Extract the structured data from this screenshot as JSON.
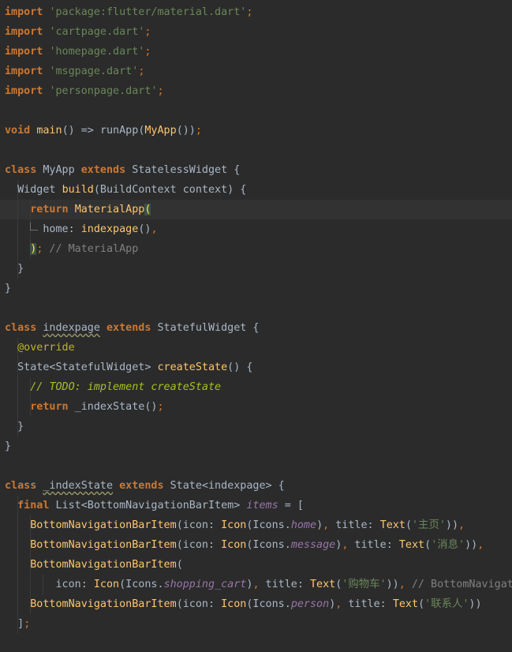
{
  "editor": {
    "lines": [
      {
        "tokens": [
          {
            "t": "import",
            "c": "kw"
          },
          {
            "t": " "
          },
          {
            "t": "'package:flutter/material.dart'",
            "c": "str"
          },
          {
            "t": ";",
            "c": "punct"
          }
        ]
      },
      {
        "tokens": [
          {
            "t": "import",
            "c": "kw"
          },
          {
            "t": " "
          },
          {
            "t": "'cartpage.dart'",
            "c": "str"
          },
          {
            "t": ";",
            "c": "punct"
          }
        ]
      },
      {
        "tokens": [
          {
            "t": "import",
            "c": "kw"
          },
          {
            "t": " "
          },
          {
            "t": "'homepage.dart'",
            "c": "str"
          },
          {
            "t": ";",
            "c": "punct"
          }
        ]
      },
      {
        "tokens": [
          {
            "t": "import",
            "c": "kw"
          },
          {
            "t": " "
          },
          {
            "t": "'msgpage.dart'",
            "c": "str"
          },
          {
            "t": ";",
            "c": "punct"
          }
        ]
      },
      {
        "tokens": [
          {
            "t": "import",
            "c": "kw"
          },
          {
            "t": " "
          },
          {
            "t": "'personpage.dart'",
            "c": "str"
          },
          {
            "t": ";",
            "c": "punct"
          }
        ]
      },
      {
        "tokens": []
      },
      {
        "tokens": [
          {
            "t": "void",
            "c": "kw"
          },
          {
            "t": " "
          },
          {
            "t": "main",
            "c": "fn"
          },
          {
            "t": "() => "
          },
          {
            "t": "runApp"
          },
          {
            "t": "("
          },
          {
            "t": "MyApp",
            "c": "fn"
          },
          {
            "t": "())"
          },
          {
            "t": ";",
            "c": "punct"
          }
        ]
      },
      {
        "tokens": []
      },
      {
        "tokens": [
          {
            "t": "class",
            "c": "kw"
          },
          {
            "t": " MyApp "
          },
          {
            "t": "extends",
            "c": "kw"
          },
          {
            "t": " StatelessWidget {"
          }
        ]
      },
      {
        "tokens": [
          {
            "t": "  Widget "
          },
          {
            "t": "build",
            "c": "fn"
          },
          {
            "t": "(BuildContext context) {"
          }
        ]
      },
      {
        "current": true,
        "tokens": [
          {
            "t": "    "
          },
          {
            "t": "return",
            "c": "kw"
          },
          {
            "t": " "
          },
          {
            "t": "MaterialApp",
            "c": "fn"
          },
          {
            "t": "(",
            "c": "hl"
          }
        ]
      },
      {
        "elbow": true,
        "tokens": [
          {
            "t": "      home: "
          },
          {
            "t": "indexpage",
            "c": "fn"
          },
          {
            "t": "()"
          },
          {
            "t": ",",
            "c": "punct"
          }
        ]
      },
      {
        "tokens": [
          {
            "t": "    "
          },
          {
            "t": ")",
            "c": "hl"
          },
          {
            "t": ";",
            "c": "punct"
          },
          {
            "t": " // MaterialApp",
            "c": "cmt"
          }
        ]
      },
      {
        "tokens": [
          {
            "t": "  }"
          }
        ]
      },
      {
        "tokens": [
          {
            "t": "}"
          }
        ]
      },
      {
        "tokens": []
      },
      {
        "tokens": [
          {
            "t": "class",
            "c": "kw"
          },
          {
            "t": " "
          },
          {
            "t": "indexpage",
            "c": "wavy"
          },
          {
            "t": " "
          },
          {
            "t": "extends",
            "c": "kw"
          },
          {
            "t": " StatefulWidget {"
          }
        ]
      },
      {
        "tokens": [
          {
            "t": "  "
          },
          {
            "t": "@override",
            "c": "ann"
          }
        ]
      },
      {
        "tokens": [
          {
            "t": "  State<StatefulWidget> "
          },
          {
            "t": "createState",
            "c": "fn"
          },
          {
            "t": "() {"
          }
        ]
      },
      {
        "tokens": [
          {
            "t": "    "
          },
          {
            "t": "// ",
            "c": "todo"
          },
          {
            "t": "TODO: implement createState",
            "c": "todo"
          }
        ]
      },
      {
        "tokens": [
          {
            "t": "    "
          },
          {
            "t": "return",
            "c": "kw"
          },
          {
            "t": " _indexState()"
          },
          {
            "t": ";",
            "c": "punct"
          }
        ]
      },
      {
        "tokens": [
          {
            "t": "  }"
          }
        ]
      },
      {
        "tokens": [
          {
            "t": "}"
          }
        ]
      },
      {
        "tokens": []
      },
      {
        "tokens": [
          {
            "t": "class",
            "c": "kw"
          },
          {
            "t": " "
          },
          {
            "t": "_indexState",
            "c": "wavy"
          },
          {
            "t": " "
          },
          {
            "t": "extends",
            "c": "kw"
          },
          {
            "t": " State<indexpage> {"
          }
        ]
      },
      {
        "tokens": [
          {
            "t": "  "
          },
          {
            "t": "final",
            "c": "kw"
          },
          {
            "t": " List<BottomNavigationBarItem> "
          },
          {
            "t": "items",
            "c": "fld"
          },
          {
            "t": " = ["
          }
        ]
      },
      {
        "tokens": [
          {
            "t": "    "
          },
          {
            "t": "BottomNavigationBarItem",
            "c": "fn"
          },
          {
            "t": "(icon: "
          },
          {
            "t": "Icon",
            "c": "fn"
          },
          {
            "t": "(Icons."
          },
          {
            "t": "home",
            "c": "fld"
          },
          {
            "t": ")"
          },
          {
            "t": ",",
            "c": "punct"
          },
          {
            "t": " title: "
          },
          {
            "t": "Text",
            "c": "fn"
          },
          {
            "t": "("
          },
          {
            "t": "'主页'",
            "c": "str"
          },
          {
            "t": "))"
          },
          {
            "t": ",",
            "c": "punct"
          }
        ]
      },
      {
        "tokens": [
          {
            "t": "    "
          },
          {
            "t": "BottomNavigationBarItem",
            "c": "fn"
          },
          {
            "t": "(icon: "
          },
          {
            "t": "Icon",
            "c": "fn"
          },
          {
            "t": "(Icons."
          },
          {
            "t": "message",
            "c": "fld"
          },
          {
            "t": ")"
          },
          {
            "t": ",",
            "c": "punct"
          },
          {
            "t": " title: "
          },
          {
            "t": "Text",
            "c": "fn"
          },
          {
            "t": "("
          },
          {
            "t": "'消息'",
            "c": "str"
          },
          {
            "t": "))"
          },
          {
            "t": ",",
            "c": "punct"
          }
        ]
      },
      {
        "tokens": [
          {
            "t": "    "
          },
          {
            "t": "BottomNavigationBarItem",
            "c": "fn"
          },
          {
            "t": "("
          }
        ]
      },
      {
        "tokens": [
          {
            "t": "        icon: "
          },
          {
            "t": "Icon",
            "c": "fn"
          },
          {
            "t": "(Icons."
          },
          {
            "t": "shopping_cart",
            "c": "fld"
          },
          {
            "t": ")"
          },
          {
            "t": ",",
            "c": "punct"
          },
          {
            "t": " title: "
          },
          {
            "t": "Text",
            "c": "fn"
          },
          {
            "t": "("
          },
          {
            "t": "'购物车'",
            "c": "str"
          },
          {
            "t": "))"
          },
          {
            "t": ",",
            "c": "punct"
          },
          {
            "t": " // BottomNavigat",
            "c": "cmt"
          }
        ]
      },
      {
        "tokens": [
          {
            "t": "    "
          },
          {
            "t": "BottomNavigationBarItem",
            "c": "fn"
          },
          {
            "t": "(icon: "
          },
          {
            "t": "Icon",
            "c": "fn"
          },
          {
            "t": "(Icons."
          },
          {
            "t": "person",
            "c": "fld"
          },
          {
            "t": ")"
          },
          {
            "t": ",",
            "c": "punct"
          },
          {
            "t": " title: "
          },
          {
            "t": "Text",
            "c": "fn"
          },
          {
            "t": "("
          },
          {
            "t": "'联系人'",
            "c": "str"
          },
          {
            "t": "))"
          }
        ]
      },
      {
        "tokens": [
          {
            "t": "  ]"
          },
          {
            "t": ";",
            "c": "punct"
          }
        ]
      }
    ]
  }
}
